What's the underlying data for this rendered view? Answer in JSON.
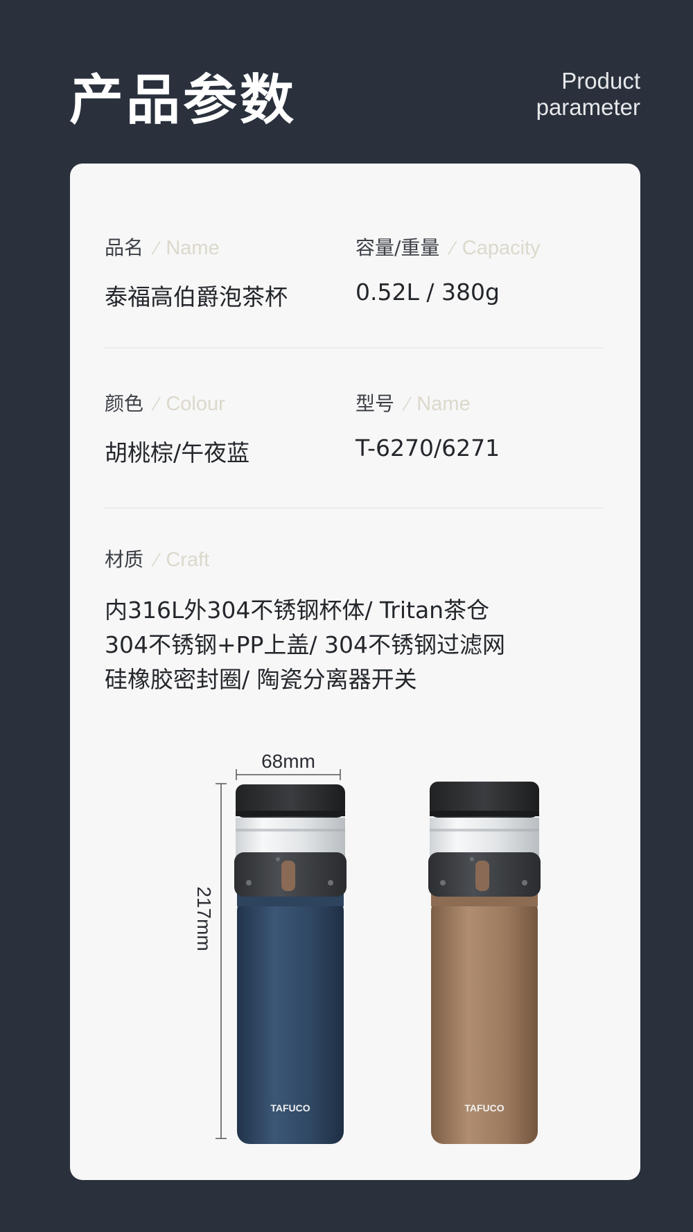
{
  "header": {
    "title_cn": "产品参数",
    "title_en_line1": "Product",
    "title_en_line2": "parameter"
  },
  "specs": {
    "name": {
      "label_cn": "品名",
      "label_en": "Name",
      "value": "泰福高伯爵泡茶杯"
    },
    "capacity": {
      "label_cn": "容量/重量",
      "label_en": "Capacity",
      "value": "0.52L / 380g"
    },
    "colour": {
      "label_cn": "颜色",
      "label_en": "Colour",
      "value": "胡桃棕/午夜蓝"
    },
    "model": {
      "label_cn": "型号",
      "label_en": "Name",
      "value": "T-6270/6271"
    },
    "craft": {
      "label_cn": "材质",
      "label_en": "Craft",
      "lines": [
        "内316L外304不锈钢杯体/ Tritan茶仓",
        "304不锈钢+PP上盖/ 304不锈钢过滤网",
        "硅橡胶密封圈/ 陶瓷分离器开关"
      ]
    }
  },
  "product": {
    "width_label": "68mm",
    "height_label": "217mm",
    "brand": "TAFUCO",
    "colors": {
      "blue": "#2f4763",
      "brown": "#9c7a5e",
      "cap": "#2b2d30",
      "band": "#3a3c3f"
    }
  }
}
